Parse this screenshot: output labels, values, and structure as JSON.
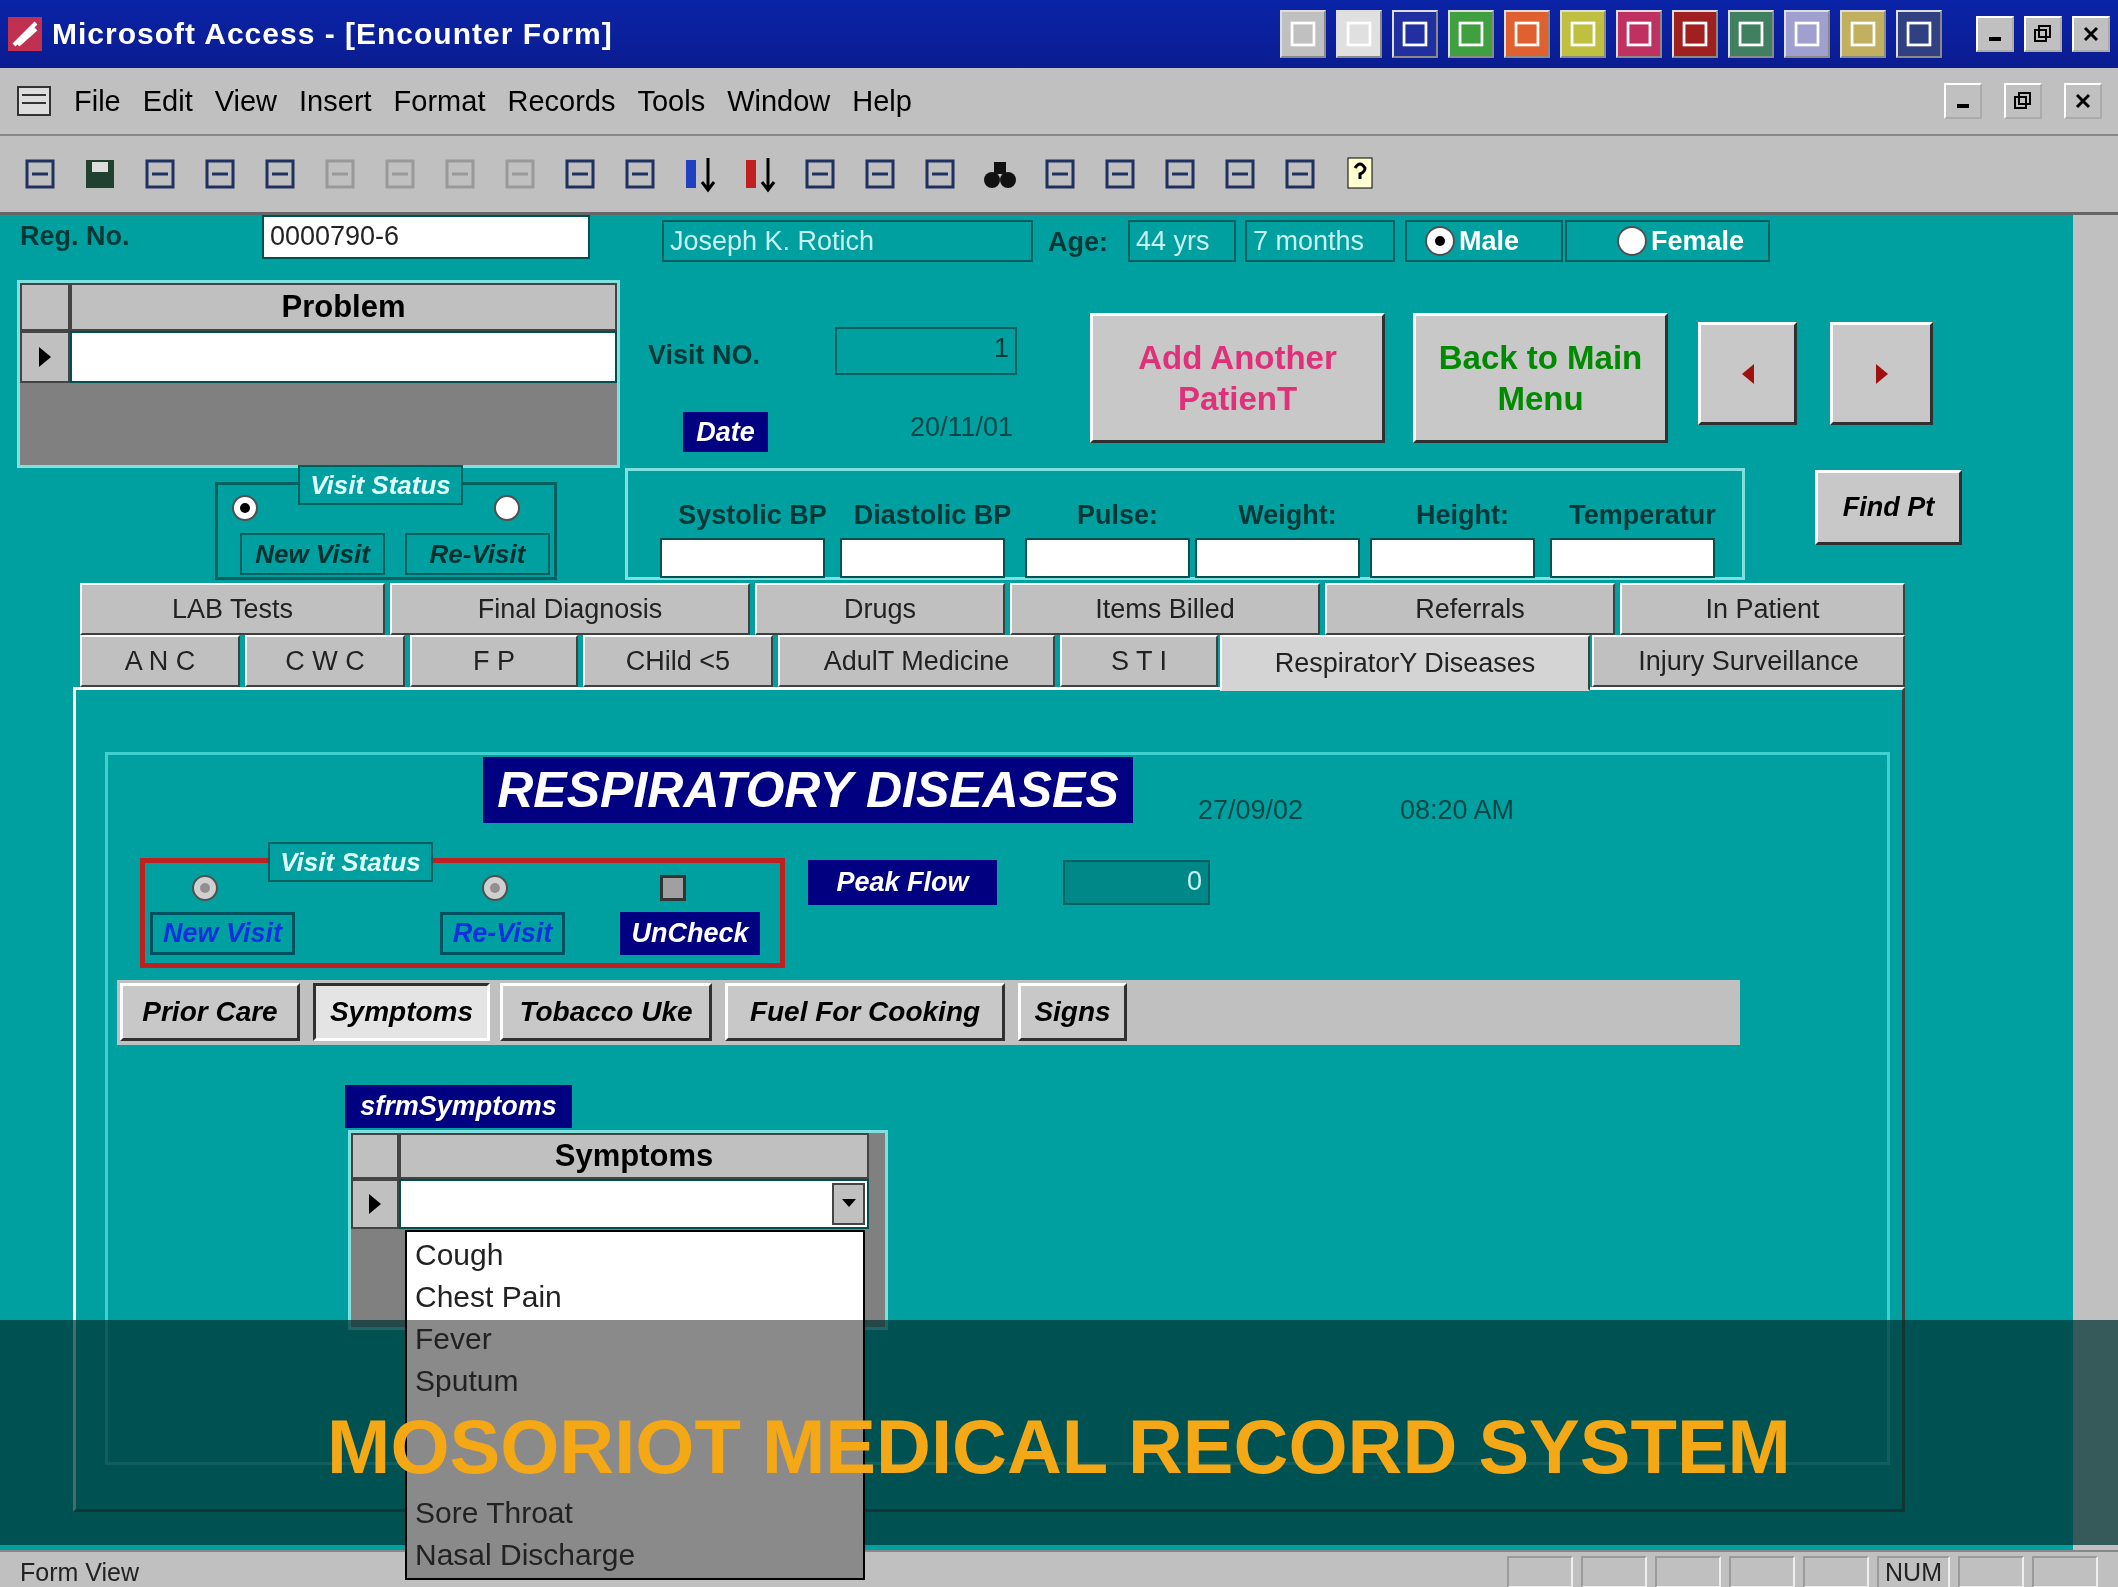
{
  "window": {
    "title": "Microsoft Access - [Encounter Form]"
  },
  "menu": [
    "File",
    "Edit",
    "View",
    "Insert",
    "Format",
    "Records",
    "Tools",
    "Window",
    "Help"
  ],
  "patient": {
    "reg_label": "Reg. No.",
    "reg_no": "0000790-6",
    "name": "Joseph K. Rotich",
    "age_label": "Age:",
    "age_years": "44  yrs",
    "age_months": "7 months",
    "sex": [
      {
        "label": "Male",
        "selected": true
      },
      {
        "label": "Female",
        "selected": false
      }
    ]
  },
  "problem_grid": {
    "column": "Problem"
  },
  "visit": {
    "label": "Visit NO.",
    "number": "1",
    "date_label": "Date",
    "date": "20/11/01"
  },
  "actions": {
    "add_patient": "Add Another PatienT",
    "main_menu": "Back to Main Menu",
    "find": "Find Pt"
  },
  "visit_status": {
    "title": "Visit Status",
    "options": [
      {
        "label": "New Visit",
        "selected": true
      },
      {
        "label": "Re-Visit",
        "selected": false
      }
    ]
  },
  "vitals": [
    "Systolic BP",
    "Diastolic BP",
    "Pulse:",
    "Weight:",
    "Height:",
    "Temperatur"
  ],
  "tab_rows": [
    {
      "tabs": [
        {
          "label": "LAB Tests",
          "selected": false
        },
        {
          "label": "Final Diagnosis",
          "selected": false
        },
        {
          "label": "Drugs",
          "selected": false
        },
        {
          "label": "Items Billed",
          "selected": false
        },
        {
          "label": "Referrals",
          "selected": false
        },
        {
          "label": "In Patient",
          "selected": false
        }
      ]
    },
    {
      "tabs": [
        {
          "label": "A N C",
          "selected": false
        },
        {
          "label": "C W C",
          "selected": false
        },
        {
          "label": "F P",
          "selected": false
        },
        {
          "label": "CHild <5",
          "selected": false
        },
        {
          "label": "AdulT Medicine",
          "selected": false
        },
        {
          "label": "S T I",
          "selected": false
        },
        {
          "label": "RespiratorY Diseases",
          "selected": true
        },
        {
          "label": "Injury Surveillance",
          "selected": false
        }
      ]
    }
  ],
  "respiratory": {
    "title": "RESPIRATORY DISEASES",
    "date": "27/09/02",
    "time": "08:20 AM",
    "visit_status": {
      "title": "Visit Status",
      "options": [
        {
          "label": "New Visit",
          "kind": "radio",
          "selected": false
        },
        {
          "label": "Re-Visit",
          "kind": "radio",
          "selected": false
        },
        {
          "label": "UnCheck",
          "kind": "checkbox",
          "checked": false
        }
      ]
    },
    "peak_flow_label": "Peak Flow",
    "peak_flow": "0",
    "subtabs": [
      {
        "label": "Prior Care",
        "selected": false
      },
      {
        "label": "Symptoms",
        "selected": true
      },
      {
        "label": "Tobacco Uke",
        "selected": false
      },
      {
        "label": "Fuel For Cooking",
        "selected": false
      },
      {
        "label": "Signs",
        "selected": false
      }
    ],
    "subform_label": "sfrmSymptoms",
    "symptoms_column": "Symptoms",
    "dropdown": [
      "Cough",
      "Chest Pain",
      "Fever",
      "Sputum",
      "Sore Throat",
      "Nasal Discharge"
    ]
  },
  "caption": "MOSORIOT MEDICAL RECORD SYSTEM",
  "status_bar": {
    "text": "Form View",
    "indicator": "NUM"
  }
}
